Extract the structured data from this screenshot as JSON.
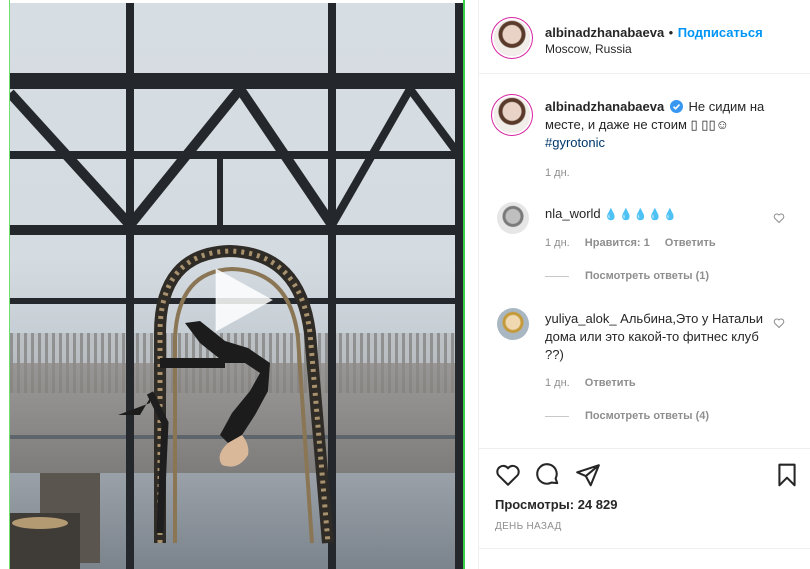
{
  "header": {
    "username": "albinadzhanabaeva",
    "separator": "•",
    "follow_label": "Подписаться",
    "location": "Moscow, Russia"
  },
  "caption": {
    "username": "albinadzhanabaeva",
    "text": "Не сидим на месте, и даже не стоим ▯ ▯▯☺",
    "hashtag": "#gyrotonic",
    "time": "1 дн."
  },
  "comments": [
    {
      "username": "nla_world",
      "text": "💧💧💧💧💧",
      "time": "1 дн.",
      "likes": "Нравится: 1",
      "reply": "Ответить",
      "view_replies": "Посмотреть ответы (1)"
    },
    {
      "username": "yuliya_alok_",
      "text": "Альбина,Это у Натальи дома или это какой-то фитнес клуб ??)",
      "time": "1 дн.",
      "reply": "Ответить",
      "view_replies": "Посмотреть ответы (4)"
    }
  ],
  "stats": {
    "views": "Просмотры: 24 829",
    "posted": "ДЕНЬ НАЗАД"
  },
  "icons": {
    "like": "heart-icon",
    "comment": "comment-icon",
    "share": "paper-plane-icon",
    "save": "bookmark-icon",
    "play": "play-icon",
    "verified": "verified-badge-icon"
  },
  "colors": {
    "follow": "#0095f6",
    "hashtag": "#00376b",
    "muted": "#8e8e8e",
    "verified": "#3897f0"
  }
}
